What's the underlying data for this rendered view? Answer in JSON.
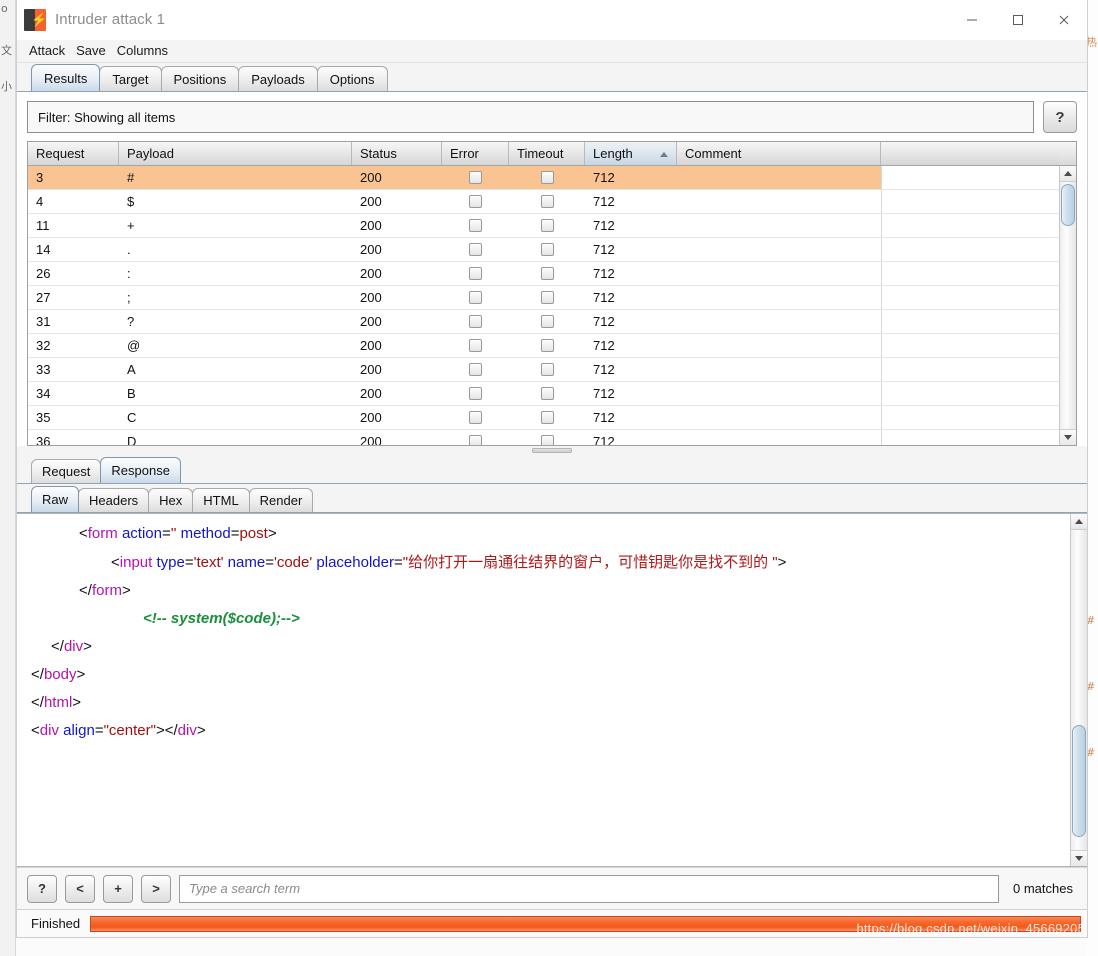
{
  "window": {
    "title": "Intruder attack 1",
    "icon": "burp-suite-icon",
    "controls": {
      "minimize": "minimize-icon",
      "maximize": "maximize-icon",
      "close": "close-icon"
    }
  },
  "menubar": {
    "items": [
      {
        "label": "Attack"
      },
      {
        "label": "Save"
      },
      {
        "label": "Columns"
      }
    ]
  },
  "main_tabs": {
    "active": "Results",
    "items": [
      {
        "label": "Results"
      },
      {
        "label": "Target"
      },
      {
        "label": "Positions"
      },
      {
        "label": "Payloads"
      },
      {
        "label": "Options"
      }
    ]
  },
  "filter": {
    "text": "Filter: Showing all items",
    "help_label": "?"
  },
  "results_table": {
    "columns": [
      {
        "label": "Request",
        "key": "request",
        "sorted": false
      },
      {
        "label": "Payload",
        "key": "payload",
        "sorted": false
      },
      {
        "label": "Status",
        "key": "status",
        "sorted": false
      },
      {
        "label": "Error",
        "key": "error",
        "sorted": false
      },
      {
        "label": "Timeout",
        "key": "timeout",
        "sorted": false
      },
      {
        "label": "Length",
        "key": "length",
        "sorted": true,
        "sort_dir": "asc"
      },
      {
        "label": "Comment",
        "key": "comment",
        "sorted": false
      }
    ],
    "selected_row": 0,
    "rows": [
      {
        "request": "3",
        "payload": "#",
        "status": "200",
        "error": false,
        "timeout": false,
        "length": "712",
        "comment": ""
      },
      {
        "request": "4",
        "payload": "$",
        "status": "200",
        "error": false,
        "timeout": false,
        "length": "712",
        "comment": ""
      },
      {
        "request": "11",
        "payload": "+",
        "status": "200",
        "error": false,
        "timeout": false,
        "length": "712",
        "comment": ""
      },
      {
        "request": "14",
        "payload": ".",
        "status": "200",
        "error": false,
        "timeout": false,
        "length": "712",
        "comment": ""
      },
      {
        "request": "26",
        "payload": ":",
        "status": "200",
        "error": false,
        "timeout": false,
        "length": "712",
        "comment": ""
      },
      {
        "request": "27",
        "payload": ";",
        "status": "200",
        "error": false,
        "timeout": false,
        "length": "712",
        "comment": ""
      },
      {
        "request": "31",
        "payload": "?",
        "status": "200",
        "error": false,
        "timeout": false,
        "length": "712",
        "comment": ""
      },
      {
        "request": "32",
        "payload": "@",
        "status": "200",
        "error": false,
        "timeout": false,
        "length": "712",
        "comment": ""
      },
      {
        "request": "33",
        "payload": "A",
        "status": "200",
        "error": false,
        "timeout": false,
        "length": "712",
        "comment": ""
      },
      {
        "request": "34",
        "payload": "B",
        "status": "200",
        "error": false,
        "timeout": false,
        "length": "712",
        "comment": ""
      },
      {
        "request": "35",
        "payload": "C",
        "status": "200",
        "error": false,
        "timeout": false,
        "length": "712",
        "comment": ""
      },
      {
        "request": "36",
        "payload": "D",
        "status": "200",
        "error": false,
        "timeout": false,
        "length": "712",
        "comment": ""
      }
    ]
  },
  "message_tabs": {
    "active": "Response",
    "items": [
      {
        "label": "Request"
      },
      {
        "label": "Response"
      }
    ]
  },
  "view_tabs": {
    "active": "Raw",
    "items": [
      {
        "label": "Raw"
      },
      {
        "label": "Headers"
      },
      {
        "label": "Hex"
      },
      {
        "label": "HTML"
      },
      {
        "label": "Render"
      }
    ]
  },
  "code": {
    "lines": [
      {
        "indent": 48,
        "tokens": [
          {
            "t": "punct",
            "s": "<"
          },
          {
            "t": "tag",
            "s": "form"
          },
          {
            "t": "punct",
            "s": " "
          },
          {
            "t": "attr",
            "s": "action"
          },
          {
            "t": "punct",
            "s": "="
          },
          {
            "t": "val",
            "s": "''"
          },
          {
            "t": "punct",
            "s": " "
          },
          {
            "t": "attr",
            "s": "method"
          },
          {
            "t": "punct",
            "s": "="
          },
          {
            "t": "val",
            "s": "post"
          },
          {
            "t": "punct",
            "s": ">"
          }
        ]
      },
      {
        "indent": 80,
        "tokens": [
          {
            "t": "punct",
            "s": "<"
          },
          {
            "t": "tag",
            "s": "input"
          },
          {
            "t": "punct",
            "s": " "
          },
          {
            "t": "attr",
            "s": "type"
          },
          {
            "t": "punct",
            "s": "="
          },
          {
            "t": "val",
            "s": "'text'"
          },
          {
            "t": "punct",
            "s": " "
          },
          {
            "t": "attr",
            "s": "name"
          },
          {
            "t": "punct",
            "s": "="
          },
          {
            "t": "val",
            "s": "'code'"
          },
          {
            "t": "punct",
            "s": " "
          },
          {
            "t": "attr",
            "s": "placeholder"
          },
          {
            "t": "punct",
            "s": "="
          },
          {
            "t": "val",
            "s": "\""
          },
          {
            "t": "cn",
            "s": "给你打开一扇通往结界的窗户，可惜钥匙你是找不到的"
          },
          {
            "t": "val",
            "s": " \""
          },
          {
            "t": "punct",
            "s": ">"
          }
        ]
      },
      {
        "indent": 48,
        "tokens": [
          {
            "t": "punct",
            "s": "</"
          },
          {
            "t": "tag",
            "s": "form"
          },
          {
            "t": "punct",
            "s": ">"
          }
        ]
      },
      {
        "indent": 112,
        "tokens": [
          {
            "t": "cmt",
            "s": "<!-- system($code);-->"
          }
        ]
      },
      {
        "indent": 20,
        "tokens": [
          {
            "t": "punct",
            "s": "</"
          },
          {
            "t": "tag",
            "s": "div"
          },
          {
            "t": "punct",
            "s": ">"
          }
        ]
      },
      {
        "indent": 0,
        "tokens": [
          {
            "t": "punct",
            "s": "</"
          },
          {
            "t": "tag",
            "s": "body"
          },
          {
            "t": "punct",
            "s": ">"
          }
        ]
      },
      {
        "indent": 0,
        "tokens": [
          {
            "t": "punct",
            "s": "</"
          },
          {
            "t": "tag",
            "s": "html"
          },
          {
            "t": "punct",
            "s": ">"
          }
        ]
      },
      {
        "indent": 0,
        "tokens": [
          {
            "t": "punct",
            "s": "<"
          },
          {
            "t": "tag",
            "s": "div"
          },
          {
            "t": "punct",
            "s": " "
          },
          {
            "t": "attr",
            "s": "align"
          },
          {
            "t": "punct",
            "s": "="
          },
          {
            "t": "val",
            "s": "\"center\""
          },
          {
            "t": "punct",
            "s": ">"
          },
          {
            "t": "punct",
            "s": "</"
          },
          {
            "t": "tag",
            "s": "div"
          },
          {
            "t": "punct",
            "s": ">"
          }
        ]
      }
    ]
  },
  "search": {
    "help_label": "?",
    "prev_label": "<",
    "add_label": "+",
    "next_label": ">",
    "placeholder": "Type a search term",
    "value": "",
    "matches": "0 matches"
  },
  "status": {
    "label": "Finished",
    "progress_percent": 100,
    "watermark": "https://blog.csdn.net/weixin_45669205"
  },
  "colors": {
    "accent_orange": "#f4622d",
    "selected_row": "#fac392",
    "progress": "#f7692e",
    "tab_active": "#c9d9e8",
    "tag": "#b313b3",
    "attr": "#1414c8",
    "value": "#a01010",
    "comment": "#1a8f3c"
  },
  "background_window": {
    "left_chars": [
      "o",
      "文",
      "小"
    ],
    "right_chars": [
      "热",
      "#",
      "#",
      "#"
    ]
  }
}
